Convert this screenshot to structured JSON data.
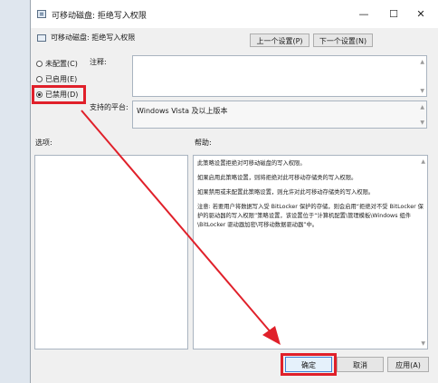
{
  "window": {
    "title": "可移动磁盘: 拒绝写入权限",
    "controls": {
      "minimize": "—",
      "maximize": "☐",
      "close": "✕"
    }
  },
  "header": {
    "policy_title": "可移动磁盘: 拒绝写入权限",
    "prev_label": "上一个设置(P)",
    "next_label": "下一个设置(N)"
  },
  "options": {
    "not_configured": "未配置(C)",
    "enabled": "已启用(E)",
    "disabled": "已禁用(D)",
    "selected": "disabled"
  },
  "comment": {
    "label": "注释:",
    "value": ""
  },
  "supported": {
    "label": "支持的平台:",
    "value": "Windows Vista 及以上版本"
  },
  "options_pane": {
    "label": "选项:"
  },
  "help_pane": {
    "label": "帮助:",
    "paragraphs": [
      "此策略设置拒绝对可移动磁盘的写入权限。",
      "如果启用此策略设置，则将拒绝对此可移动存储类的写入权限。",
      "如果禁用或未配置此策略设置，则允许对此可移动存储类的写入权限。",
      "注意: 若要用户将数据写入受 BitLocker 保护的存储，则会启用“拒绝对不受 BitLocker 保护的驱动器的写入权限”策略设置，该设置位于“计算机配置\\管理模板\\Windows 组件\\BitLocker 驱动器加密\\可移动数据驱动器”中。"
    ]
  },
  "footer": {
    "ok_label": "确定",
    "cancel_label": "取消",
    "apply_label": "应用(A)"
  },
  "colors": {
    "highlight": "#e0202a",
    "window_bg": "#f0f0f0"
  }
}
